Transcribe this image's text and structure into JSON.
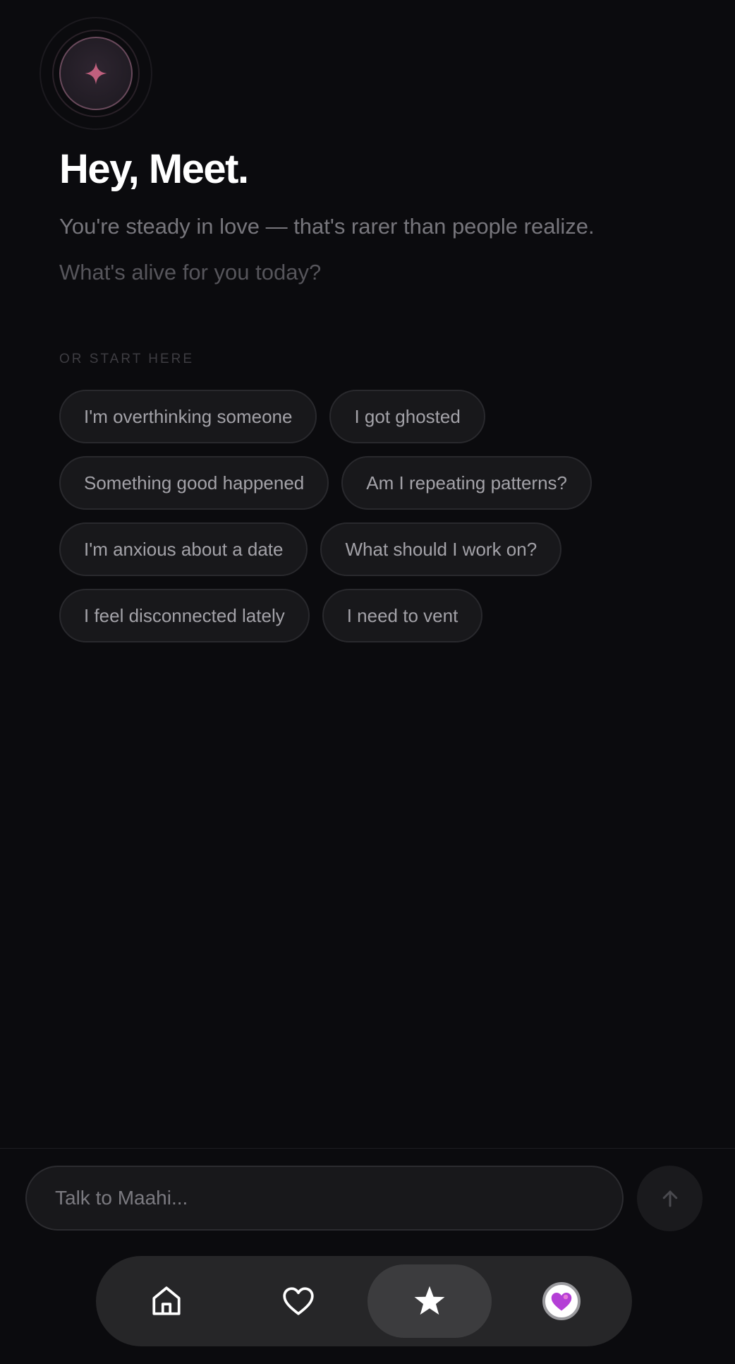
{
  "header": {
    "greeting": "Hey, Meet.",
    "subline": "You're steady in love — that's rarer than people realize.",
    "prompt": "What's alive for you today?",
    "avatar_icon": "sparkle-icon"
  },
  "suggestions": {
    "section_label": "OR START HERE",
    "rows": [
      [
        "I'm overthinking someone",
        "I got ghosted"
      ],
      [
        "Something good happened",
        "Am I repeating patterns?"
      ],
      [
        "I'm anxious about a date",
        "What should I work on?"
      ],
      [
        "I feel disconnected lately",
        "I need to vent"
      ]
    ]
  },
  "composer": {
    "placeholder": "Talk to Maahi...",
    "send_icon": "arrow-up-icon"
  },
  "tabbar": {
    "tabs": [
      {
        "icon": "home-icon",
        "active": false
      },
      {
        "icon": "heart-icon",
        "active": false
      },
      {
        "icon": "star-icon",
        "active": true
      },
      {
        "icon": "profile-avatar-icon",
        "active": false
      }
    ]
  },
  "colors": {
    "background": "#0b0b0e",
    "accent_pink": "#c0607e",
    "chip_bg": "#18181b",
    "tabbar_bg": "#262628"
  }
}
